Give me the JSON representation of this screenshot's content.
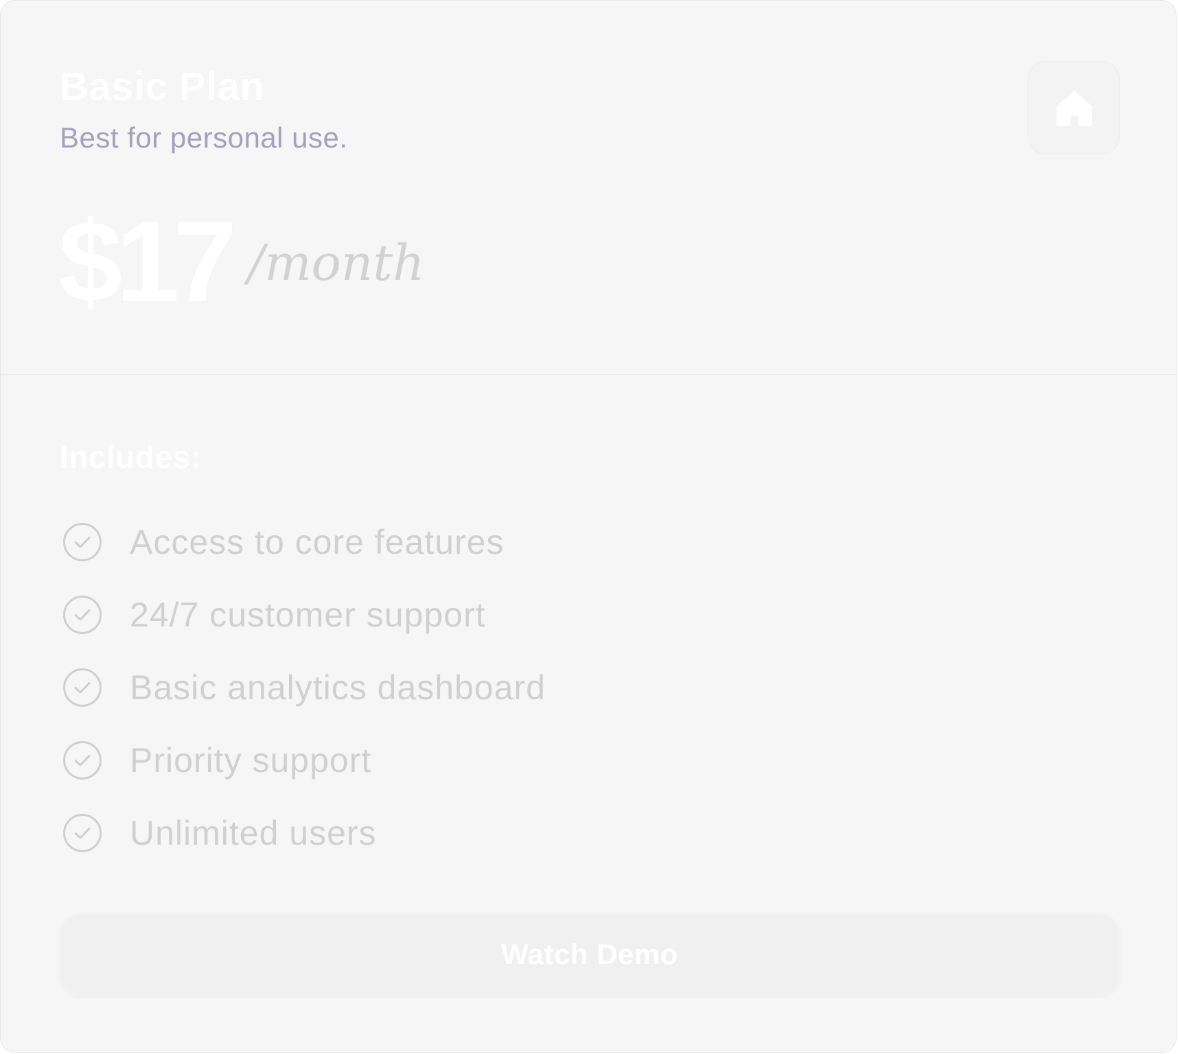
{
  "plan": {
    "title": "Basic Plan",
    "subtitle": "Best for personal use.",
    "icon": "home-icon"
  },
  "pricing": {
    "amount": "$17",
    "period": "/month"
  },
  "includes": {
    "heading": "Includes:",
    "items": [
      {
        "label": "Access to core features",
        "icon": "check-circle-icon"
      },
      {
        "label": "24/7 customer support",
        "icon": "check-circle-icon"
      },
      {
        "label": "Basic analytics dashboard",
        "icon": "check-circle-icon"
      },
      {
        "label": "Priority support",
        "icon": "check-circle-icon"
      },
      {
        "label": "Unlimited users",
        "icon": "check-circle-icon"
      }
    ]
  },
  "cta": {
    "label": "Watch Demo"
  },
  "colors": {
    "card_background": "#f6f6f6",
    "subtitle": "#a4a1b9",
    "feature_text": "#d0d0d0",
    "check_icon": "#cfcfcf",
    "button_background": "#f0f0f0"
  }
}
